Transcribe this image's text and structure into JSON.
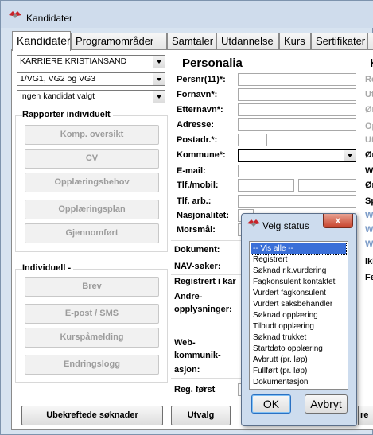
{
  "window": {
    "title": "Kandidater"
  },
  "tabs": [
    "Kandidater",
    "Programområder",
    "Samtaler",
    "Utdannelse",
    "Kurs",
    "Sertifikater",
    "Pr"
  ],
  "filters": {
    "office": "KARRIERE KRISTIANSAND",
    "level": "1/VG1, VG2 og VG3",
    "candidate": "Ingen kandidat valgt"
  },
  "reports": {
    "title": "Rapporter individuelt",
    "buttons": [
      "Komp. oversikt",
      "CV",
      "Opplæringsbehov",
      "Opplæringsplan",
      "Gjennomført"
    ]
  },
  "individual": {
    "title": "Individuell -",
    "buttons": [
      "Brev",
      "E-post / SMS",
      "Kurspåmelding",
      "Endringslogg"
    ]
  },
  "bottom": {
    "confirm": "Ubekreftede søknader",
    "select": "Utvalg",
    "partial": "re"
  },
  "personalia": {
    "title": "Personalia",
    "fields": [
      "Persnr(11)*:",
      "Fornavn*:",
      "Etternavn*:",
      "Adresse:",
      "Postadr.*:",
      "Kommune*:",
      "E-mail:",
      "Tlf./mobil:",
      "Tlf. arb.:",
      "Nasjonalitet:",
      "Morsmål:"
    ],
    "extra": [
      "Dokument:",
      "NAV-søker:",
      "Registrert i kar",
      "Andre-",
      "opplysninger:",
      "Web-",
      "kommunik-",
      "asjon:",
      "Reg. først"
    ]
  },
  "right_column": {
    "title": "K",
    "labels": [
      "Re",
      "Ut",
      "Ør",
      "Op",
      "Ut",
      "Ør",
      "We",
      "Ør",
      "Sp",
      "W",
      "W",
      "W",
      "Ikl",
      "Fe"
    ]
  },
  "dialog": {
    "title": "Velg status",
    "close": "x",
    "options": [
      "-- Vis alle --",
      "Registrert",
      "Søknad r.k.vurdering",
      "Fagkonsulent kontaktet",
      "Vurdert fagkonsulent",
      "Vurdert saksbehandler",
      "Søknad opplæring",
      "Tilbudt opplæring",
      "Søknad trukket",
      "Startdato opplæring",
      "Avbrutt (pr. løp)",
      "Fullført (pr. løp)",
      "Dokumentasjon"
    ],
    "selected": "-- Vis alle --",
    "ok": "OK",
    "cancel": "Avbryt"
  },
  "colors": {
    "accent": "#3a6fd8",
    "close": "#c7432c",
    "logo": "#c8242a"
  }
}
